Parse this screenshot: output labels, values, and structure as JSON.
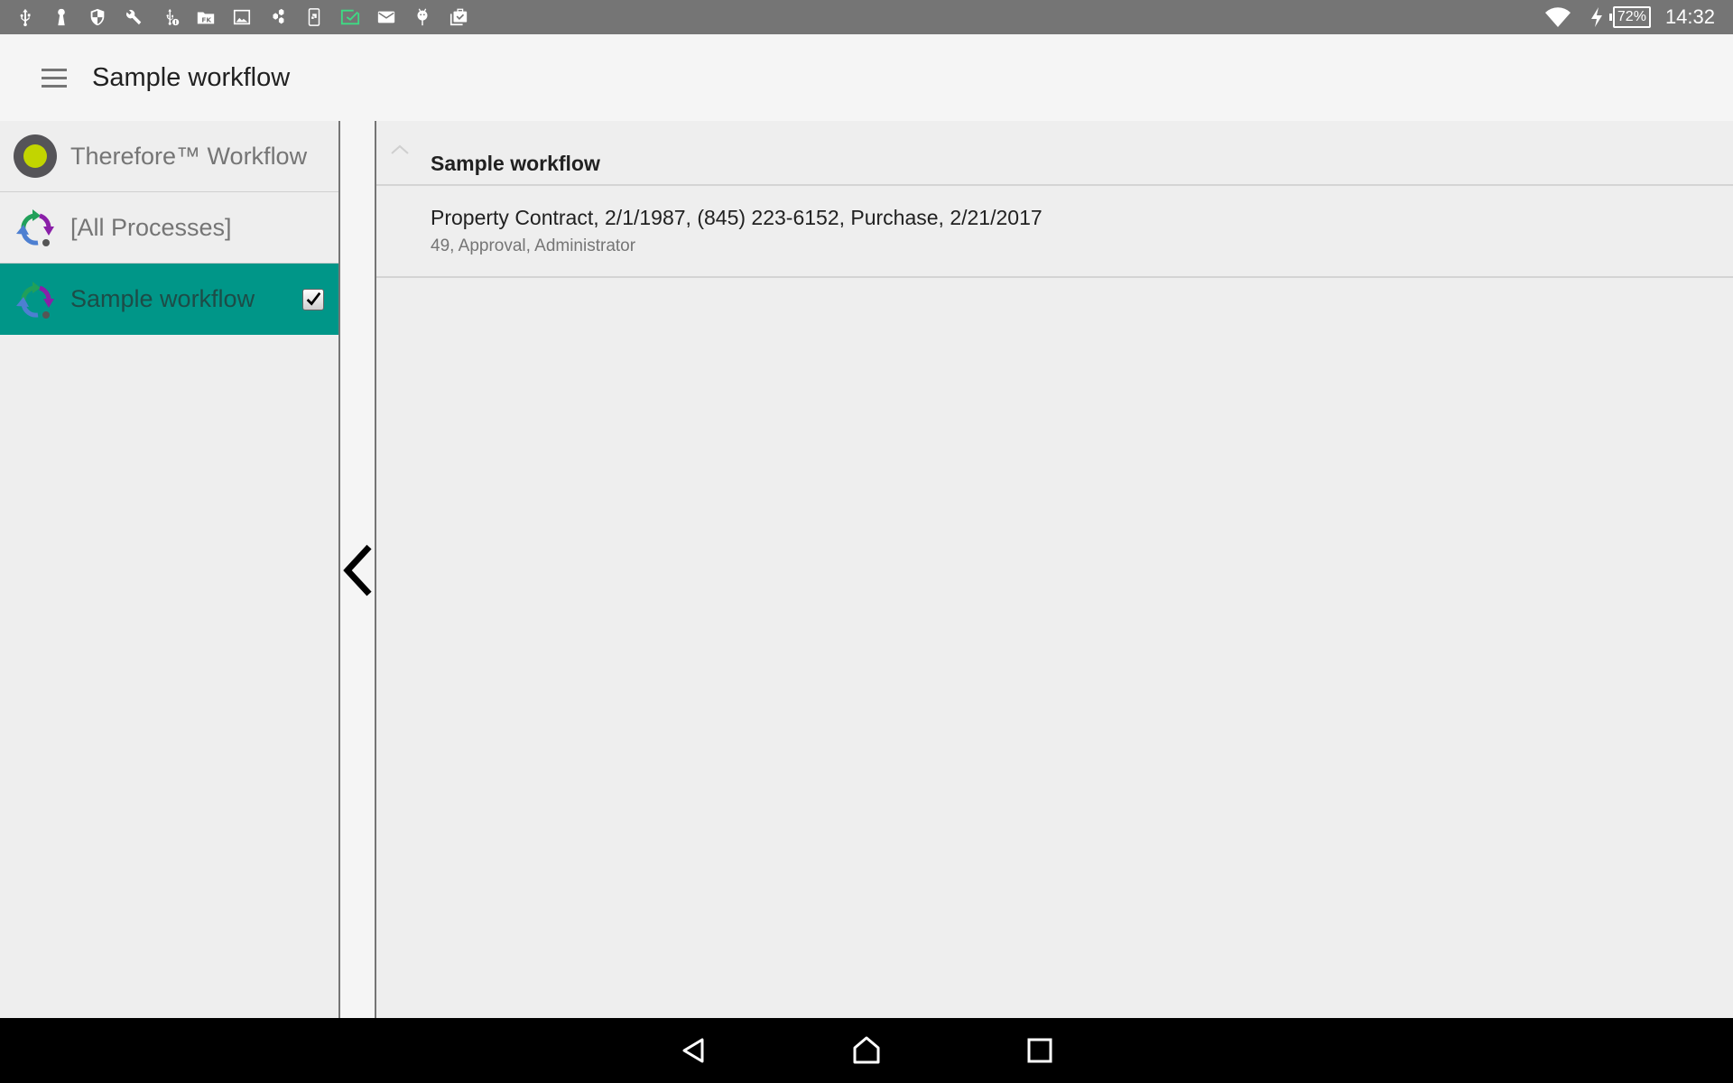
{
  "status_bar": {
    "icons": [
      "usb-icon",
      "keyhole-icon",
      "shield-icon",
      "wrench-icon",
      "usb-debug-icon",
      "folder-fk-icon",
      "image-icon",
      "hexagons-icon",
      "phone-screen-icon",
      "mail-check-icon",
      "mail-icon",
      "android-icon",
      "clipboard-check-icon"
    ],
    "wifi": "wifi-icon",
    "charging": "bolt-icon",
    "battery": "72%",
    "time": "14:32",
    "accent_icon_color": "#3ddc84"
  },
  "app_bar": {
    "menu_icon": "hamburger-menu-icon",
    "title": "Sample workflow"
  },
  "sidebar": {
    "items": [
      {
        "label": "Therefore™ Workflow",
        "icon": "therefore-logo-icon",
        "selected": false
      },
      {
        "label": "[All Processes]",
        "icon": "process-cycle-icon",
        "selected": false
      },
      {
        "label": "Sample workflow",
        "icon": "process-cycle-icon",
        "selected": true,
        "checked": true
      }
    ],
    "selected_color": "#009688"
  },
  "collapse": {
    "icon": "chevron-left-icon"
  },
  "main": {
    "group": {
      "title": "Sample workflow",
      "toggle_icon": "chevron-up-icon"
    },
    "rows": [
      {
        "primary": "Property Contract, 2/1/1987, (845) 223-6152, Purchase, 2/21/2017",
        "secondary": "49, Approval, Administrator"
      }
    ]
  },
  "nav_bar": {
    "back": "back-icon",
    "home": "home-icon",
    "recents": "recents-icon"
  }
}
